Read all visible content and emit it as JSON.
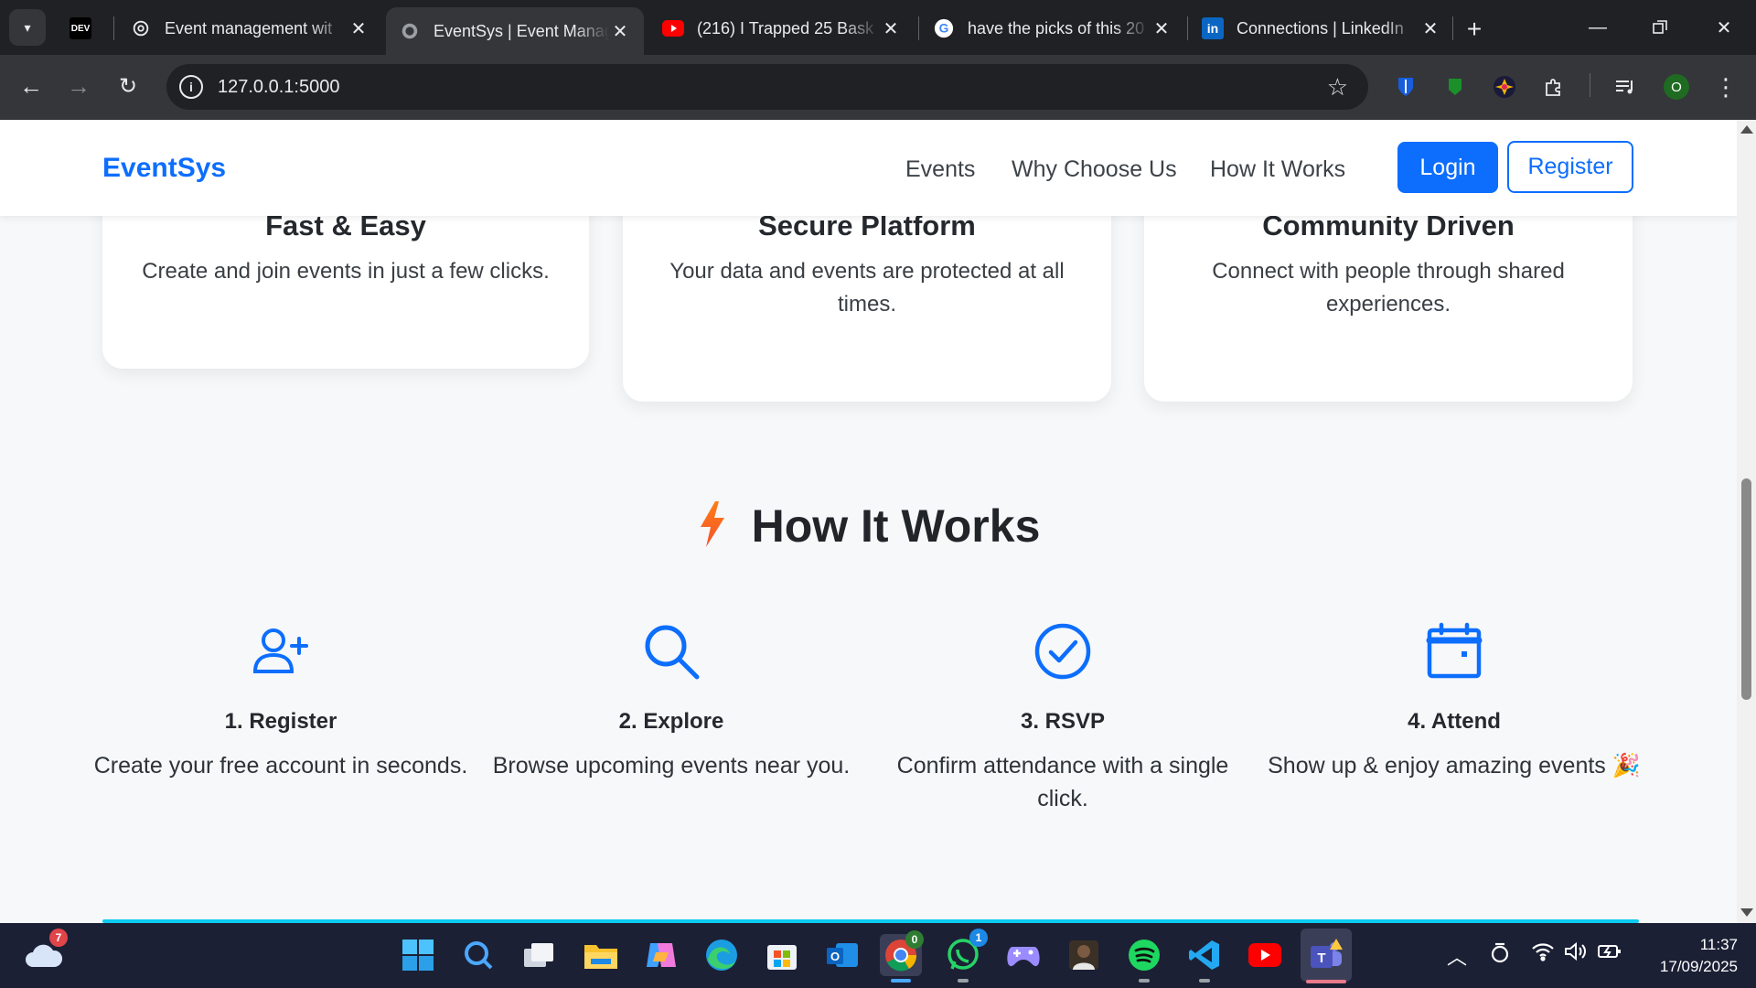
{
  "browser": {
    "tabs": [
      {
        "favicon": "DEV",
        "title": ""
      },
      {
        "favicon": "chatgpt-icon",
        "title": "Event management wit"
      },
      {
        "favicon": "globe-icon",
        "title": "EventSys | Event Manag"
      },
      {
        "favicon": "youtube-icon",
        "title": "(216) I Trapped 25 Bask"
      },
      {
        "favicon": "google-icon",
        "title": "have the picks of this 20"
      },
      {
        "favicon": "linkedin-icon",
        "title": "Connections | LinkedIn"
      }
    ],
    "url": "127.0.0.1:5000",
    "profile_initial": "O"
  },
  "site": {
    "brand": "EventSys",
    "nav": {
      "events": "Events",
      "why": "Why Choose Us",
      "how": "How It Works",
      "login": "Login",
      "register": "Register"
    },
    "features": [
      {
        "title": "Fast & Easy",
        "text": "Create and join events in just a few clicks."
      },
      {
        "title": "Secure Platform",
        "text": "Your data and events are protected at all times."
      },
      {
        "title": "Community Driven",
        "text": "Connect with people through shared experiences."
      }
    ],
    "how_title": "How It Works",
    "steps": [
      {
        "title": "1. Register",
        "text": "Create your free account in seconds.",
        "icon": "user-plus-icon"
      },
      {
        "title": "2. Explore",
        "text": "Browse upcoming events near you.",
        "icon": "search-icon"
      },
      {
        "title": "3. RSVP",
        "text": "Confirm attendance with a single click.",
        "icon": "check-circle-icon"
      },
      {
        "title": "4. Attend",
        "text": "Show up & enjoy amazing events 🎉",
        "icon": "calendar-icon"
      }
    ]
  },
  "taskbar": {
    "weather_badge": "7",
    "chrome_badge": "0",
    "whatsapp_badge": "1",
    "time": "11:37",
    "date": "17/09/2025"
  },
  "colors": {
    "primary": "#0d6efd",
    "text_dark": "#212529",
    "page_bg": "#f6f8fa",
    "accent_bolt": "#fd7e14"
  }
}
